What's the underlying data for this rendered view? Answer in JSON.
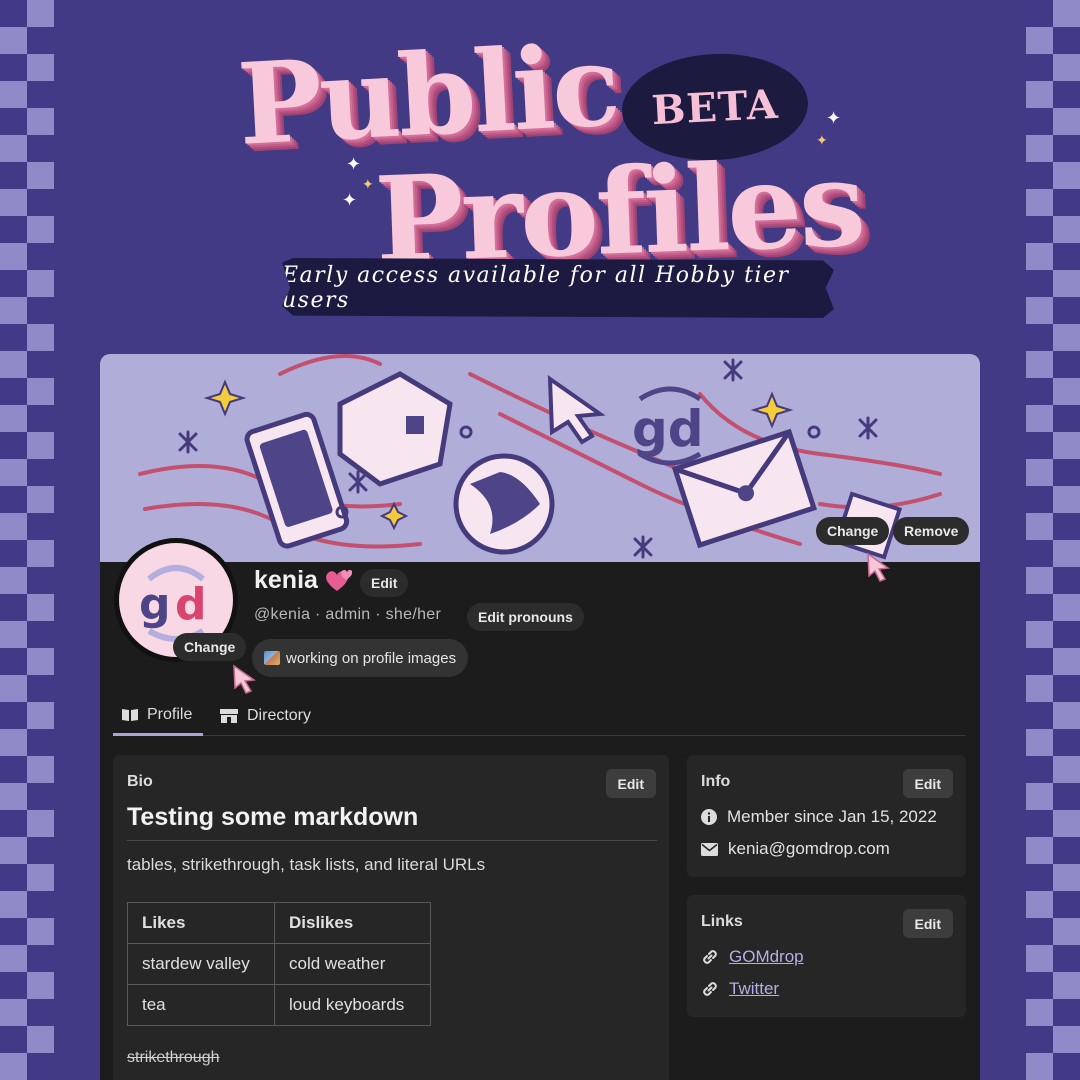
{
  "header": {
    "title_line1": "Public",
    "title_line2": "Profiles",
    "badge": "BETA",
    "tagline": "Early access available for all Hobby tier users"
  },
  "colors": {
    "background": "#423a85",
    "title_pink": "#f7c9db",
    "card_bg": "#1c1c1c",
    "banner_bg": "#b0add9",
    "accent": "#a8a4dc"
  },
  "banner": {
    "change_label": "Change",
    "remove_label": "Remove"
  },
  "avatar": {
    "change_label": "Change",
    "logo_text": "gd"
  },
  "profile": {
    "name": "kenia",
    "name_emoji": "two-hearts-icon",
    "edit_label": "Edit",
    "handle": "@kenia",
    "role": "admin",
    "pronouns": "she/her",
    "edit_pronouns_label": "Edit pronouns",
    "status": "working on profile images",
    "status_icon": "framed-picture-icon"
  },
  "tabs": [
    {
      "label": "Profile",
      "icon": "open-book-icon",
      "active": true
    },
    {
      "label": "Directory",
      "icon": "storefront-icon",
      "active": false
    }
  ],
  "bio": {
    "title": "Bio",
    "edit_label": "Edit",
    "heading": "Testing some markdown",
    "text": "tables, strikethrough, task lists, and literal URLs",
    "table": {
      "headers": [
        "Likes",
        "Dislikes"
      ],
      "rows": [
        [
          "stardew valley",
          "cold weather"
        ],
        [
          "tea",
          "loud keyboards"
        ]
      ]
    },
    "strikethrough_text": "strikethrough"
  },
  "info": {
    "title": "Info",
    "edit_label": "Edit",
    "member_since": "Member since Jan 15, 2022",
    "email": "kenia@gomdrop.com"
  },
  "links": {
    "title": "Links",
    "edit_label": "Edit",
    "items": [
      "GOMdrop",
      "Twitter"
    ]
  }
}
